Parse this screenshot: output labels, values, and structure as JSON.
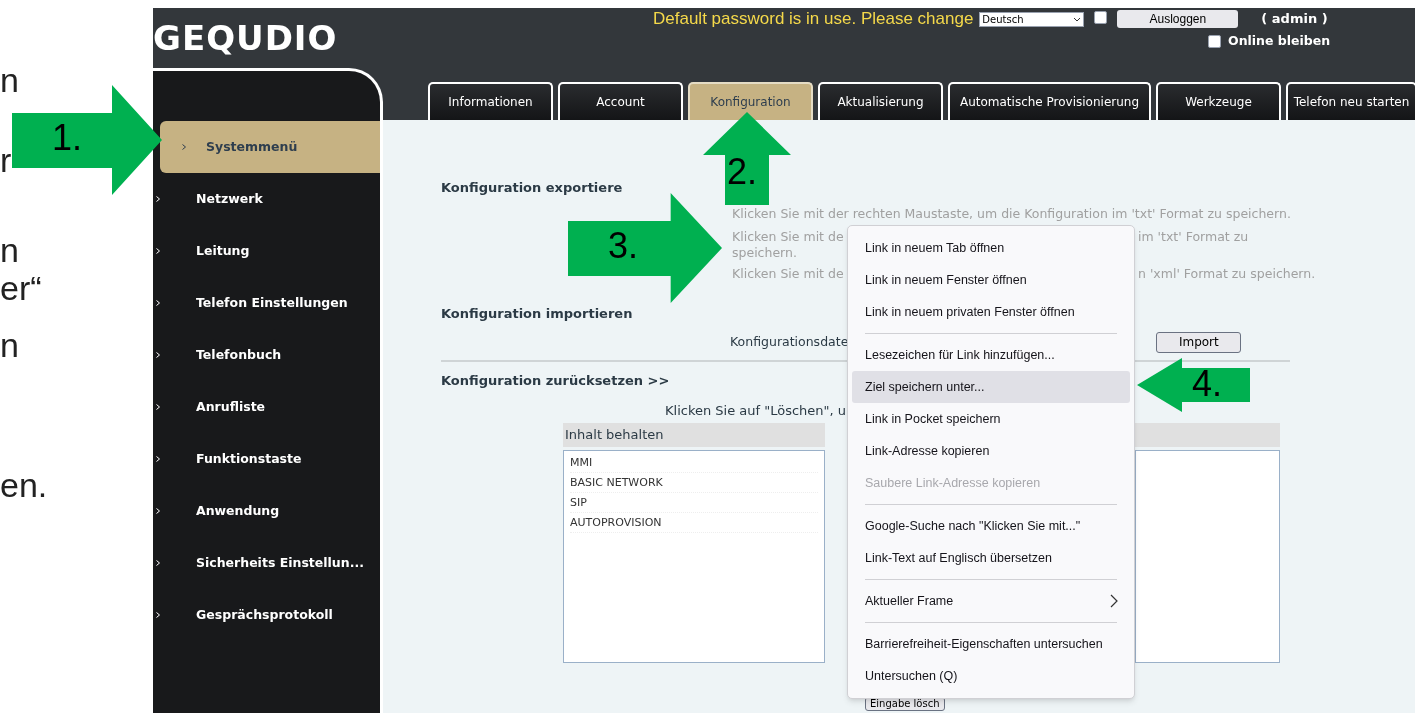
{
  "slide_text": [
    "n",
    "r",
    "n",
    "er“",
    "n",
    "en."
  ],
  "callouts": [
    {
      "label": "1.",
      "kind": "right"
    },
    {
      "label": "2.",
      "kind": "up"
    },
    {
      "label": "3.",
      "kind": "right"
    },
    {
      "label": "4.",
      "kind": "left"
    }
  ],
  "logo": "GEQUDIO",
  "header": {
    "warning": "Default password is in use. Please change",
    "language": "Deutsch",
    "remember_checked": false,
    "logout": "Ausloggen",
    "user": "( admin )",
    "stay_online": {
      "label": "Online bleiben",
      "checked": false
    }
  },
  "tabs": [
    {
      "label": "Informationen",
      "selected": false
    },
    {
      "label": "Account",
      "selected": false
    },
    {
      "label": "Konfiguration",
      "selected": true
    },
    {
      "label": "Aktualisierung",
      "selected": false
    },
    {
      "label": "Automatische Provisionierung",
      "selected": false
    },
    {
      "label": "Werkzeuge",
      "selected": false
    },
    {
      "label": "Telefon neu starten",
      "selected": false
    }
  ],
  "sidebar": {
    "items": [
      {
        "label": "Systemmenü",
        "selected": true
      },
      {
        "label": "Netzwerk",
        "selected": false
      },
      {
        "label": "Leitung",
        "selected": false
      },
      {
        "label": "Telefon Einstellungen",
        "selected": false
      },
      {
        "label": "Telefonbuch",
        "selected": false
      },
      {
        "label": "Anrufliste",
        "selected": false
      },
      {
        "label": "Funktionstaste",
        "selected": false
      },
      {
        "label": "Anwendung",
        "selected": false
      },
      {
        "label": "Sicherheits Einstellun...",
        "selected": false
      },
      {
        "label": "Gesprächsprotokoll",
        "selected": false
      }
    ]
  },
  "export": {
    "title": "Konfiguration exportiere",
    "line_1": "Klicken Sie mit der rechten Maustaste, um die Konfiguration im 'txt' Format zu speichern.",
    "line_2_left": "Klicken Sie mit de",
    "line_2_right": "im 'txt' Format zu",
    "line_2_wrap": "speichern.",
    "line_3_left": "Klicken Sie mit de",
    "line_3_right": "n 'xml' Format zu speichern."
  },
  "import": {
    "title": "Konfiguration importieren",
    "file_label": "Konfigurationsdate",
    "button": "Import"
  },
  "reset": {
    "title": "Konfiguration zurücksetzen >>",
    "hint": "Klicken Sie auf \"Löschen\", u",
    "keep_header": "Inhalt behalten",
    "keep_items": [
      "MMI",
      "BASIC NETWORK",
      "SIP",
      "AUTOPROVISION"
    ],
    "button": "Eingabe lösch"
  },
  "context_menu": [
    {
      "kind": "item",
      "label": "Link in neuem Tab öffnen",
      "selected": false,
      "disabled": false
    },
    {
      "kind": "item",
      "label": "Link in neuem Fenster öffnen",
      "selected": false,
      "disabled": false
    },
    {
      "kind": "item",
      "label": "Link in neuem privaten Fenster öffnen",
      "selected": false,
      "disabled": false
    },
    {
      "kind": "separator"
    },
    {
      "kind": "item",
      "label": "Lesezeichen für Link hinzufügen...",
      "selected": false,
      "disabled": false
    },
    {
      "kind": "item",
      "label": "Ziel speichern unter...",
      "selected": true,
      "disabled": false
    },
    {
      "kind": "item",
      "label": "Link in Pocket speichern",
      "selected": false,
      "disabled": false
    },
    {
      "kind": "item",
      "label": "Link-Adresse kopieren",
      "selected": false,
      "disabled": false
    },
    {
      "kind": "item",
      "label": "Saubere Link-Adresse kopieren",
      "selected": false,
      "disabled": true
    },
    {
      "kind": "separator"
    },
    {
      "kind": "item",
      "label": "Google-Suche nach \"Klicken Sie mit...\"",
      "selected": false,
      "disabled": false
    },
    {
      "kind": "item",
      "label": "Link-Text auf Englisch übersetzen",
      "selected": false,
      "disabled": false
    },
    {
      "kind": "separator"
    },
    {
      "kind": "submenu",
      "label": "Aktueller Frame",
      "selected": false,
      "disabled": false
    },
    {
      "kind": "separator"
    },
    {
      "kind": "item",
      "label": "Barrierefreiheit-Eigenschaften untersuchen",
      "selected": false,
      "disabled": false
    },
    {
      "kind": "item",
      "label": "Untersuchen (Q)",
      "selected": false,
      "disabled": false
    }
  ]
}
